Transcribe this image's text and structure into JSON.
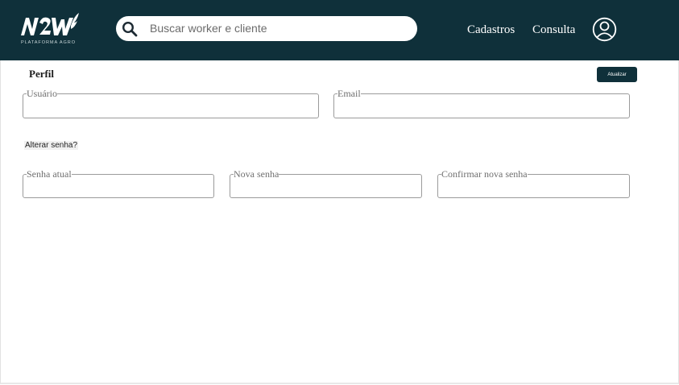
{
  "header": {
    "logo_text": "N2W",
    "logo_subtitle": "PLATAFORMA AGRO",
    "search_placeholder": "Buscar worker e cliente",
    "nav": [
      "Cadastros",
      "Consulta"
    ]
  },
  "profile": {
    "title": "Perfil",
    "update_label": "Atualizar",
    "fields": {
      "usuario": {
        "label": "Usuário",
        "value": ""
      },
      "email": {
        "label": "Email",
        "value": ""
      }
    },
    "change_password_label": "Alterar senha?",
    "password_fields": {
      "current": {
        "label": "Senha atual",
        "value": ""
      },
      "new": {
        "label": "Nova senha",
        "value": ""
      },
      "confirm": {
        "label": "Confirmar nova senha",
        "value": ""
      }
    }
  },
  "colors": {
    "navbar": "#0f303a",
    "button": "#0f303a",
    "field_border": "#9b9b9b"
  },
  "icons": [
    "logo",
    "search-icon",
    "user-avatar-icon"
  ]
}
